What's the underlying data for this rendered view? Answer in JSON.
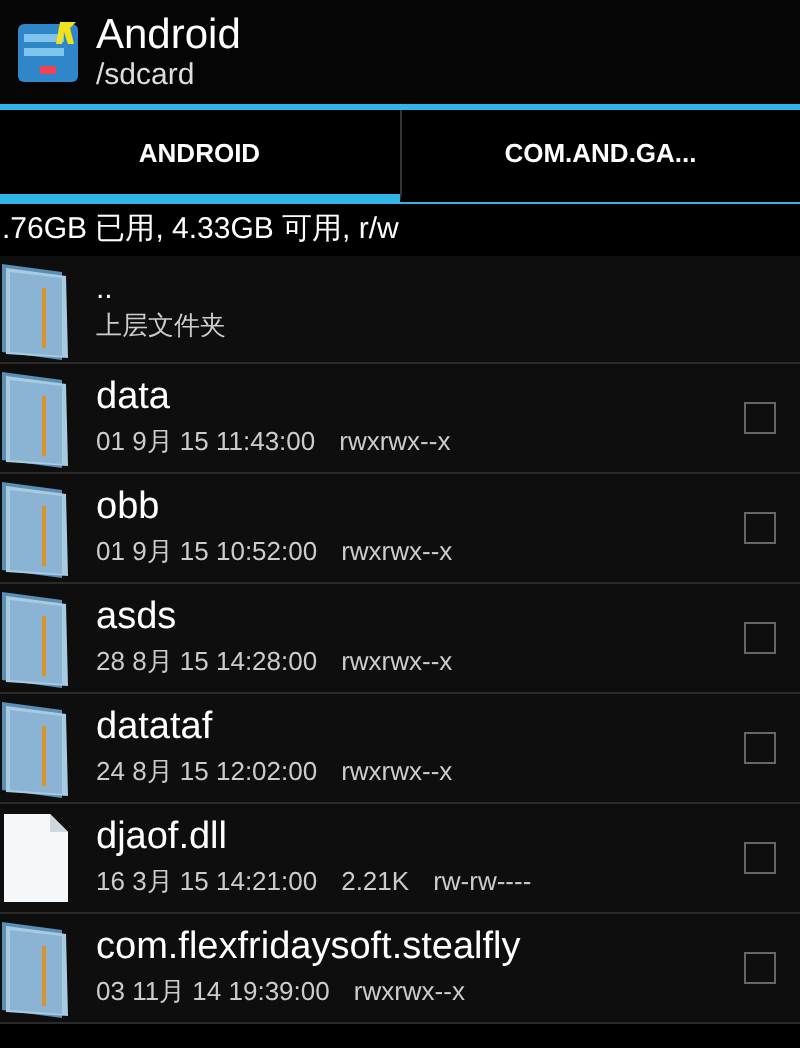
{
  "header": {
    "title": "Android",
    "path": "/sdcard"
  },
  "tabs": [
    {
      "label": "ANDROID",
      "selected": true
    },
    {
      "label": "COM.AND.GA...",
      "selected": false
    }
  ],
  "storage": ".76GB 已用, 4.33GB 可用, r/w",
  "files": [
    {
      "kind": "parent",
      "name": "..",
      "subtitle": "上层文件夹"
    },
    {
      "kind": "folder",
      "name": "data",
      "date": "01 9月 15 11:43:00",
      "permissions": "rwxrwx--x",
      "checked": false
    },
    {
      "kind": "folder",
      "name": "obb",
      "date": "01 9月 15 10:52:00",
      "permissions": "rwxrwx--x",
      "checked": false
    },
    {
      "kind": "folder",
      "name": "asds",
      "date": "28 8月 15 14:28:00",
      "permissions": "rwxrwx--x",
      "checked": false
    },
    {
      "kind": "folder",
      "name": "datataf",
      "date": "24 8月 15 12:02:00",
      "permissions": "rwxrwx--x",
      "checked": false
    },
    {
      "kind": "file",
      "name": "djaof.dll",
      "date": "16 3月 15 14:21:00",
      "size": "2.21K",
      "permissions": "rw-rw----",
      "checked": false
    },
    {
      "kind": "folder",
      "name": "com.flexfridaysoft.stealfly",
      "date": "03 11月 14 19:39:00",
      "permissions": "rwxrwx--x",
      "checked": false
    }
  ]
}
